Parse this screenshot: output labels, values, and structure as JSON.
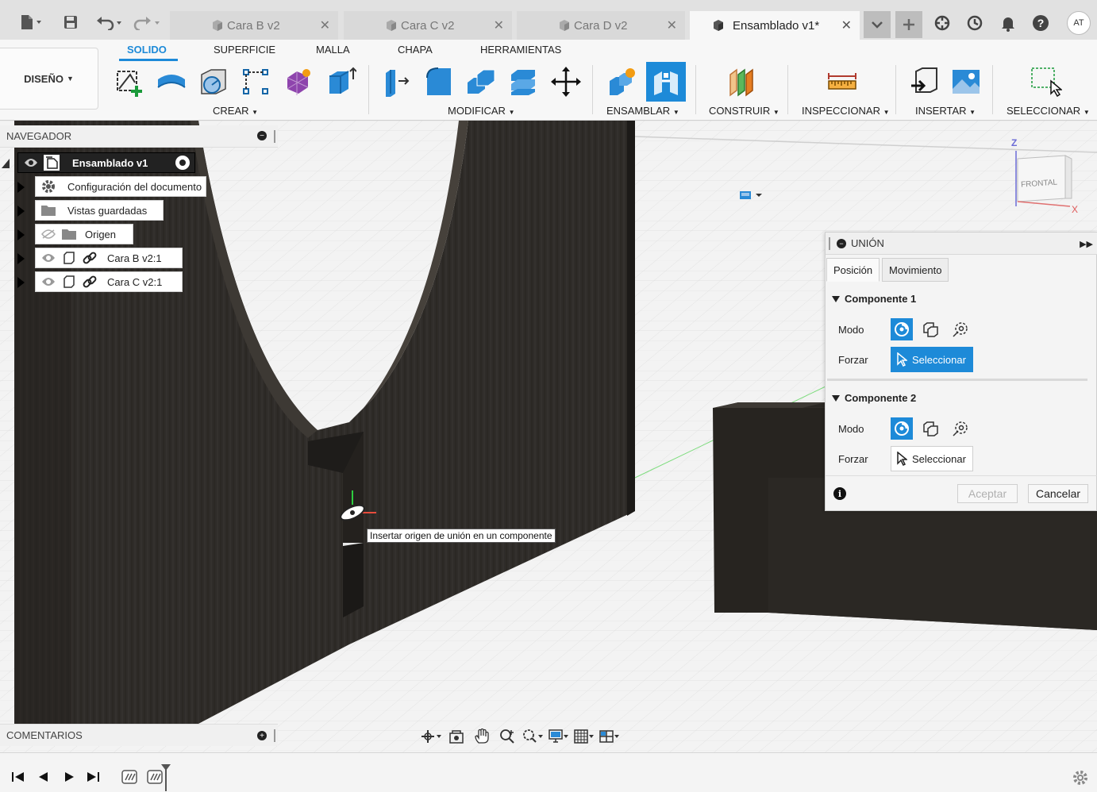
{
  "tabs": [
    {
      "label": "Cara B v2",
      "active": false
    },
    {
      "label": "Cara C v2",
      "active": false
    },
    {
      "label": "Cara D v2",
      "active": false
    },
    {
      "label": "Ensamblado v1*",
      "active": true
    }
  ],
  "user_initials": "AT",
  "ribbon": {
    "workspace": "DISEÑO",
    "tabs": [
      "SOLIDO",
      "SUPERFICIE",
      "MALLA",
      "CHAPA",
      "HERRAMIENTAS"
    ],
    "groups": [
      "CREAR",
      "MODIFICAR",
      "ENSAMBLAR",
      "CONSTRUIR",
      "INSPECCIONAR",
      "INSERTAR",
      "SELECCIONAR"
    ]
  },
  "browser": {
    "title": "NAVEGADOR",
    "root": "Ensamblado v1",
    "items": [
      {
        "label": "Configuración del documento",
        "icon": "gear-icon"
      },
      {
        "label": "Vistas guardadas",
        "icon": "folder-icon"
      },
      {
        "label": "Origen",
        "icon": "folder-icon"
      },
      {
        "label": "Cara B v2:1",
        "icon": "component-icon"
      },
      {
        "label": "Cara C v2:1",
        "icon": "component-icon"
      }
    ]
  },
  "comments": {
    "title": "COMENTARIOS"
  },
  "tooltip": "Insertar origen de unión en un componente",
  "viewcube": {
    "face": "FRONTAL",
    "z": "Z",
    "x": "X"
  },
  "joint_dialog": {
    "title": "UNIÓN",
    "tabs": [
      "Posición",
      "Movimiento"
    ],
    "component1": {
      "title": "Componente 1",
      "mode_label": "Modo",
      "snap_label": "Forzar",
      "select_label": "Seleccionar"
    },
    "component2": {
      "title": "Componente 2",
      "mode_label": "Modo",
      "snap_label": "Forzar",
      "select_label": "Seleccionar"
    },
    "ok": "Aceptar",
    "cancel": "Cancelar"
  },
  "colors": {
    "accent": "#1d8ad8",
    "wood": "#2f2c29",
    "background": "#f3f3f3"
  }
}
